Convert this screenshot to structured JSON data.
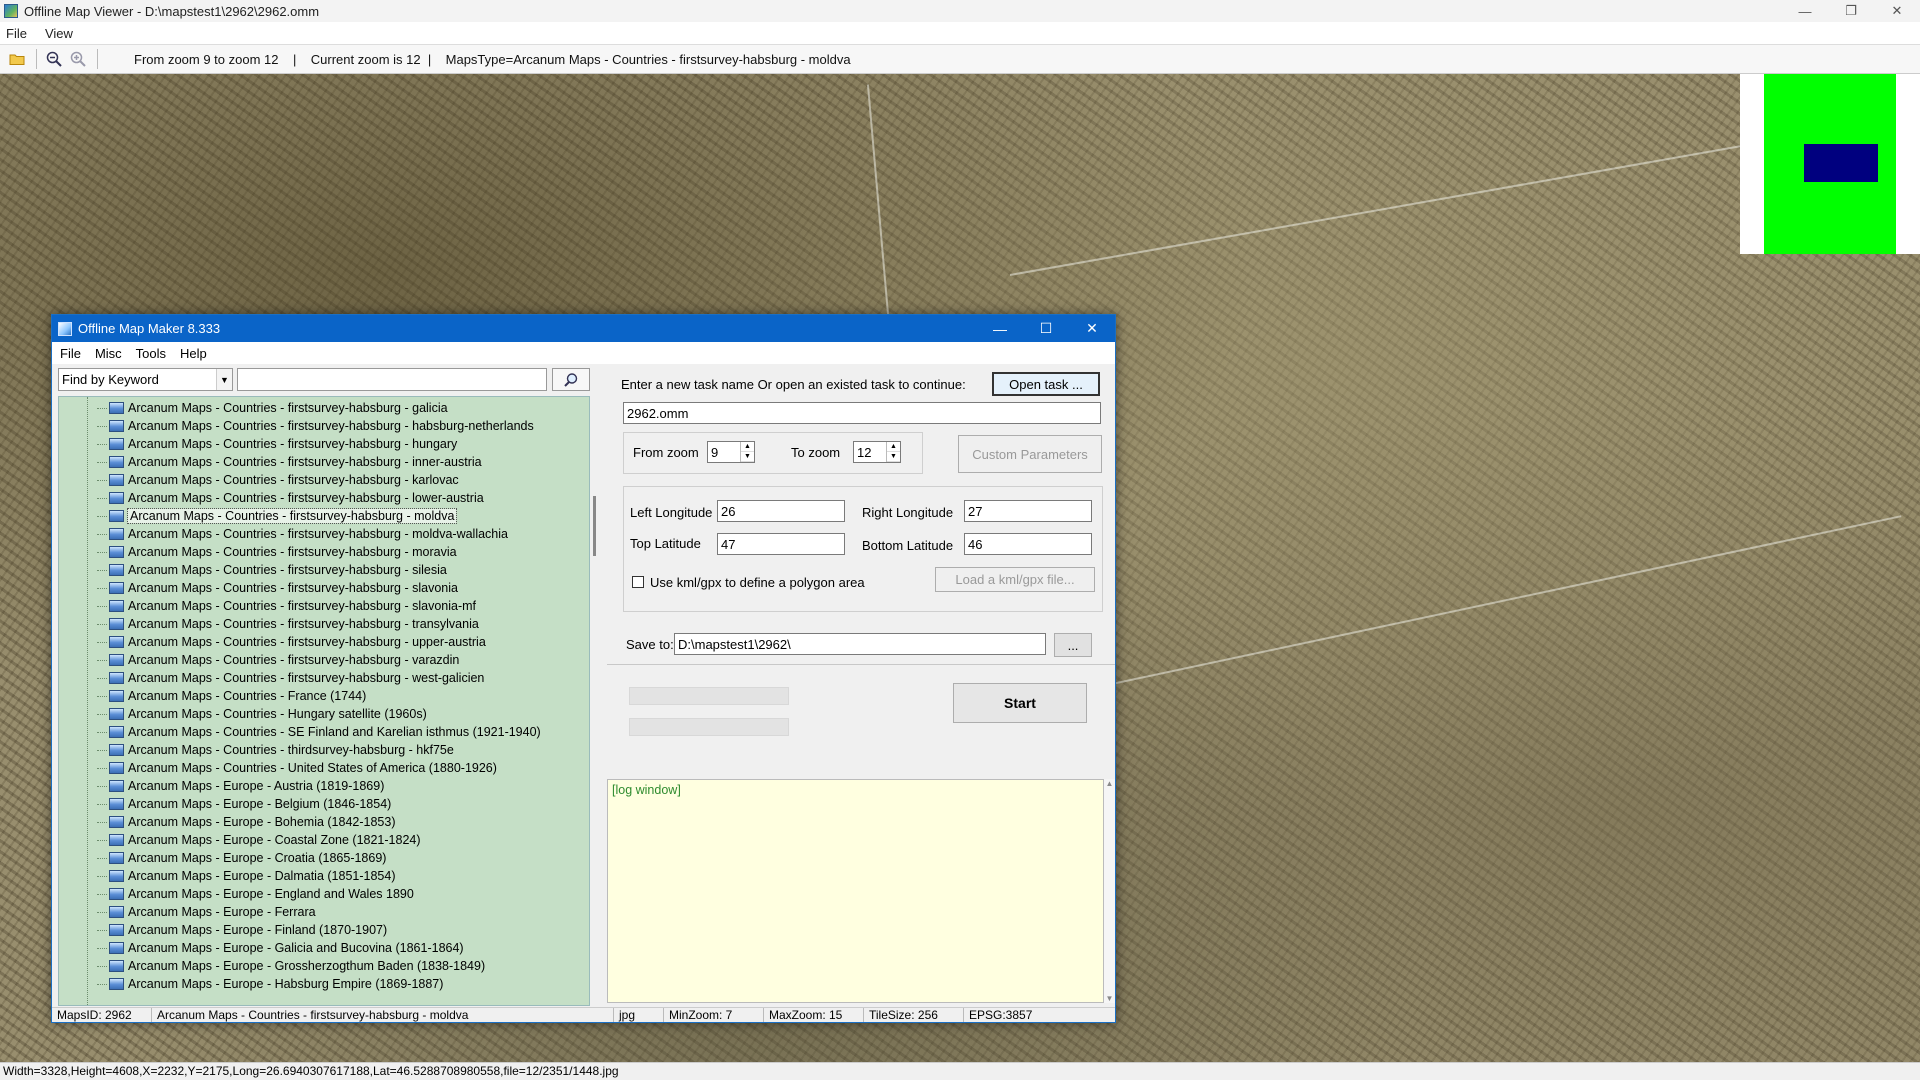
{
  "viewer": {
    "title": "Offline Map Viewer - D:\\mapstest1\\2962\\2962.omm",
    "menu": [
      "File",
      "View"
    ],
    "toolbar_info": "From zoom 9 to zoom 12    |    Current zoom is 12  |    MapsType=Arcanum Maps - Countries - firstsurvey-habsburg - moldva",
    "status": "Width=3328,Height=4608,X=2232,Y=2175,Long=26.6940307617188,Lat=46.5288708980558,file=12/2351/1448.jpg"
  },
  "dialog": {
    "title": "Offline Map Maker 8.333",
    "menu": [
      "File",
      "Misc",
      "Tools",
      "Help"
    ],
    "search_mode": "Find by Keyword",
    "search_value": "",
    "tree_items": [
      "Arcanum Maps - Countries - firstsurvey-habsburg - galicia",
      "Arcanum Maps - Countries - firstsurvey-habsburg - habsburg-netherlands",
      "Arcanum Maps - Countries - firstsurvey-habsburg - hungary",
      "Arcanum Maps - Countries - firstsurvey-habsburg - inner-austria",
      "Arcanum Maps - Countries - firstsurvey-habsburg - karlovac",
      "Arcanum Maps - Countries - firstsurvey-habsburg - lower-austria",
      "Arcanum Maps - Countries - firstsurvey-habsburg - moldva",
      "Arcanum Maps - Countries - firstsurvey-habsburg - moldva-wallachia",
      "Arcanum Maps - Countries - firstsurvey-habsburg - moravia",
      "Arcanum Maps - Countries - firstsurvey-habsburg - silesia",
      "Arcanum Maps - Countries - firstsurvey-habsburg - slavonia",
      "Arcanum Maps - Countries - firstsurvey-habsburg - slavonia-mf",
      "Arcanum Maps - Countries - firstsurvey-habsburg - transylvania",
      "Arcanum Maps - Countries - firstsurvey-habsburg - upper-austria",
      "Arcanum Maps - Countries - firstsurvey-habsburg - varazdin",
      "Arcanum Maps - Countries - firstsurvey-habsburg - west-galicien",
      "Arcanum Maps - Countries - France (1744)",
      "Arcanum Maps - Countries - Hungary satellite (1960s)",
      "Arcanum Maps - Countries - SE Finland and Karelian isthmus (1921-1940)",
      "Arcanum Maps - Countries - thirdsurvey-habsburg - hkf75e",
      "Arcanum Maps - Countries - United States of America (1880-1926)",
      "Arcanum Maps - Europe - Austria (1819-1869)",
      "Arcanum Maps - Europe - Belgium (1846-1854)",
      "Arcanum Maps - Europe - Bohemia (1842-1853)",
      "Arcanum Maps - Europe - Coastal Zone (1821-1824)",
      "Arcanum Maps - Europe - Croatia (1865-1869)",
      "Arcanum Maps - Europe - Dalmatia (1851-1854)",
      "Arcanum Maps - Europe - England and Wales 1890",
      "Arcanum Maps - Europe - Ferrara",
      "Arcanum Maps - Europe - Finland (1870-1907)",
      "Arcanum Maps - Europe - Galicia and Bucovina (1861-1864)",
      "Arcanum Maps - Europe - Grossherzogthum Baden (1838-1849)",
      "Arcanum Maps - Europe - Habsburg Empire (1869-1887)"
    ],
    "selected_index": 6,
    "task_prompt": "Enter a new task name Or open an existed task to continue:",
    "open_task_label": "Open task ...",
    "task_name": "2962.omm",
    "from_zoom_label": "From zoom",
    "from_zoom": "9",
    "to_zoom_label": "To zoom",
    "to_zoom": "12",
    "custom_params_label": "Custom Parameters",
    "left_lon_label": "Left Longitude",
    "left_lon": "26",
    "right_lon_label": "Right Longitude",
    "right_lon": "27",
    "top_lat_label": "Top Latitude",
    "top_lat": "47",
    "bottom_lat_label": "Bottom Latitude",
    "bottom_lat": "46",
    "kml_label": "Use kml/gpx to define a polygon area",
    "load_kml_label": "Load a kml/gpx file...",
    "save_to_label": "Save to:",
    "save_to": "D:\\mapstest1\\2962\\",
    "browse_label": "...",
    "start_label": "Start",
    "log_text": "[log window]",
    "status": {
      "maps_id": "MapsID: 2962",
      "maps_name": "Arcanum Maps - Countries - firstsurvey-habsburg - moldva",
      "format": "jpg",
      "min_zoom": "MinZoom: 7",
      "max_zoom": "MaxZoom: 15",
      "tile_size": "TileSize: 256",
      "epsg": "EPSG:3857"
    }
  }
}
